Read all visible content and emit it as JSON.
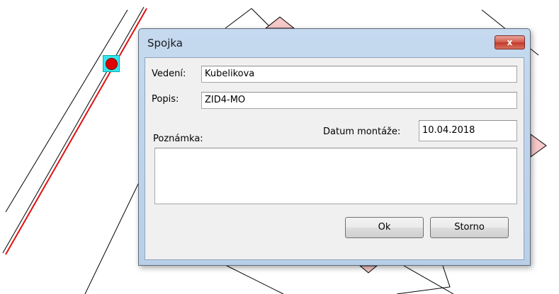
{
  "dialog": {
    "title": "Spojka",
    "close_label": "x",
    "fields": {
      "vedeni_label": "Vedení:",
      "vedeni_value": "Kubelikova",
      "popis_label": "Popis:",
      "popis_value": "ZID4-MO",
      "datum_label": "Datum montáže:",
      "datum_value": "10.04.2018",
      "poznamka_label": "Poznámka:",
      "poznamka_value": ""
    },
    "buttons": {
      "ok_label": "Ok",
      "storno_label": "Storno"
    }
  },
  "colors": {
    "line_red": "#e01010",
    "marker_cyan": "#33e6ee",
    "marker_red": "#e00000",
    "shape_pink": "#f6c8c8"
  }
}
